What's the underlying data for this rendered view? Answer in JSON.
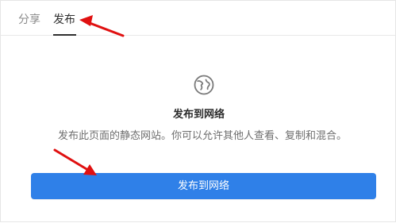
{
  "tabs": {
    "share": "分享",
    "publish": "发布"
  },
  "main": {
    "title": "发布到网络",
    "description": "发布此页面的静态网站。你可以允许其他人查看、复制和混合。",
    "button": "发布到网络"
  },
  "colors": {
    "accent": "#2f80e8",
    "arrow": "#e01010"
  },
  "icons": {
    "globe": "globe-icon"
  }
}
